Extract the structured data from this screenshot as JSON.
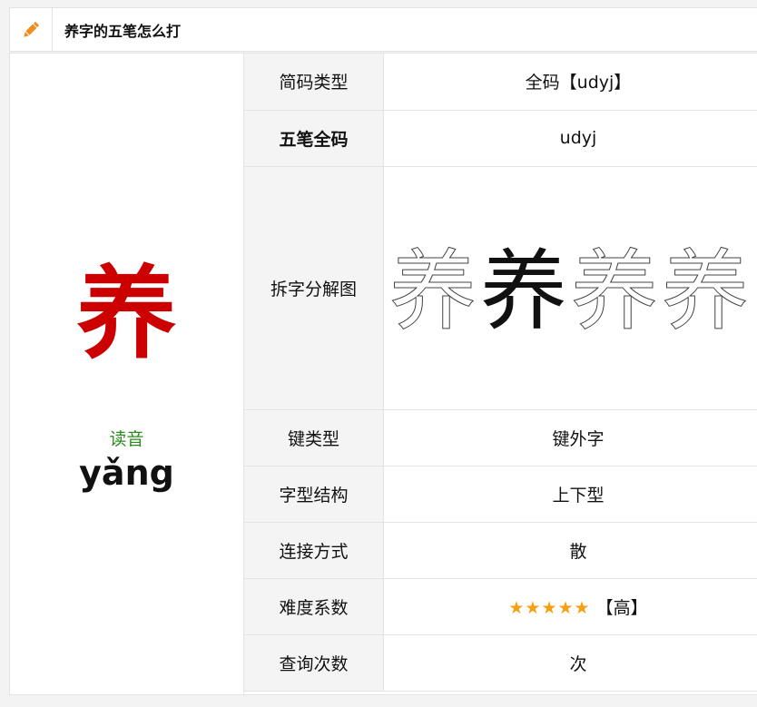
{
  "header": {
    "title": "养字的五笔怎么打"
  },
  "character": {
    "glyph": "养",
    "pron_label": "读音",
    "pinyin": "yǎng"
  },
  "rows": [
    {
      "key": "简码类型",
      "value": "全码【udyj】"
    },
    {
      "key": "五笔全码",
      "value": "udyj"
    },
    {
      "key": "拆字分解图",
      "value": ""
    },
    {
      "key": "键类型",
      "value": "键外字"
    },
    {
      "key": "字型结构",
      "value": "上下型"
    },
    {
      "key": "连接方式",
      "value": "散"
    },
    {
      "key": "难度系数",
      "value_stars": "★★★★★",
      "value_suffix": "【高】"
    },
    {
      "key": "查询次数",
      "value": "次"
    }
  ],
  "decomposition": {
    "glyph": "养",
    "steps": 4
  },
  "colors": {
    "accent": "#f08c1e",
    "char_red": "#cc0000",
    "pron_green": "#2d8a20",
    "star": "#f5a010"
  }
}
